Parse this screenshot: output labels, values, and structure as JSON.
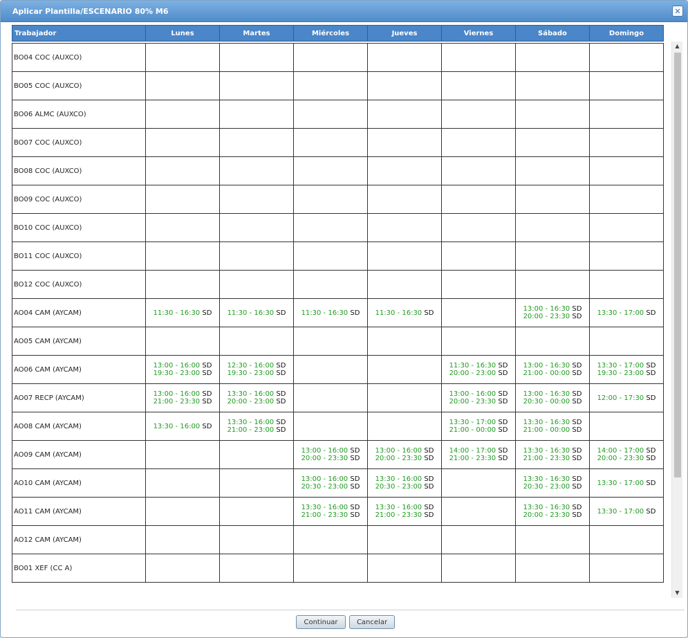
{
  "dialog": {
    "title": "Aplicar Plantilla/ESCENARIO 80% M6",
    "close_label": "✕"
  },
  "table": {
    "headers": [
      "Trabajador",
      "Lunes",
      "Martes",
      "Miércoles",
      "Jueves",
      "Viernes",
      "Sábado",
      "Domingo"
    ],
    "rows": [
      {
        "worker": "BO04 COC (AUXCO)",
        "days": [
          [],
          [],
          [],
          [],
          [],
          [],
          []
        ]
      },
      {
        "worker": "BO05 COC (AUXCO)",
        "days": [
          [],
          [],
          [],
          [],
          [],
          [],
          []
        ]
      },
      {
        "worker": "BO06 ALMC (AUXCO)",
        "days": [
          [],
          [],
          [],
          [],
          [],
          [],
          []
        ]
      },
      {
        "worker": "BO07 COC (AUXCO)",
        "days": [
          [],
          [],
          [],
          [],
          [],
          [],
          []
        ]
      },
      {
        "worker": "BO08 COC (AUXCO)",
        "days": [
          [],
          [],
          [],
          [],
          [],
          [],
          []
        ]
      },
      {
        "worker": "BO09 COC (AUXCO)",
        "days": [
          [],
          [],
          [],
          [],
          [],
          [],
          []
        ]
      },
      {
        "worker": "BO10 COC (AUXCO)",
        "days": [
          [],
          [],
          [],
          [],
          [],
          [],
          []
        ]
      },
      {
        "worker": "BO11 COC (AUXCO)",
        "days": [
          [],
          [],
          [],
          [],
          [],
          [],
          []
        ]
      },
      {
        "worker": "BO12 COC (AUXCO)",
        "days": [
          [],
          [],
          [],
          [],
          [],
          [],
          []
        ]
      },
      {
        "worker": "AO04 CAM (AYCAM)",
        "days": [
          [
            [
              "11:30 - 16:30",
              "SD"
            ]
          ],
          [
            [
              "11:30 - 16:30",
              "SD"
            ]
          ],
          [
            [
              "11:30 - 16:30",
              "SD"
            ]
          ],
          [
            [
              "11:30 - 16:30",
              "SD"
            ]
          ],
          [],
          [
            [
              "13:00 - 16:30",
              "SD"
            ],
            [
              "20:00 - 23:30",
              "SD"
            ]
          ],
          [
            [
              "13:30 - 17:00",
              "SD"
            ]
          ]
        ]
      },
      {
        "worker": "AO05 CAM (AYCAM)",
        "days": [
          [],
          [],
          [],
          [],
          [],
          [],
          []
        ]
      },
      {
        "worker": "AO06 CAM (AYCAM)",
        "days": [
          [
            [
              "13:00 - 16:00",
              "SD"
            ],
            [
              "19:30 - 23:00",
              "SD"
            ]
          ],
          [
            [
              "12:30 - 16:00",
              "SD"
            ],
            [
              "19:30 - 23:00",
              "SD"
            ]
          ],
          [],
          [],
          [
            [
              "11:30 - 16:30",
              "SD"
            ],
            [
              "20:00 - 23:00",
              "SD"
            ]
          ],
          [
            [
              "13:00 - 16:30",
              "SD"
            ],
            [
              "21:00 - 00:00",
              "SD"
            ]
          ],
          [
            [
              "13:30 - 17:00",
              "SD"
            ],
            [
              "19:30 - 23:00",
              "SD"
            ]
          ]
        ]
      },
      {
        "worker": "AO07 RECP (AYCAM)",
        "days": [
          [
            [
              "13:00 - 16:00",
              "SD"
            ],
            [
              "21:00 - 23:30",
              "SD"
            ]
          ],
          [
            [
              "13:30 - 16:00",
              "SD"
            ],
            [
              "20:00 - 23:00",
              "SD"
            ]
          ],
          [],
          [],
          [
            [
              "13:00 - 16:00",
              "SD"
            ],
            [
              "20:00 - 23:30",
              "SD"
            ]
          ],
          [
            [
              "13:00 - 16:30",
              "SD"
            ],
            [
              "20:30 - 00:00",
              "SD"
            ]
          ],
          [
            [
              "12:00 - 17:30",
              "SD"
            ]
          ]
        ]
      },
      {
        "worker": "AO08 CAM (AYCAM)",
        "days": [
          [
            [
              "13:30 - 16:00",
              "SD"
            ]
          ],
          [
            [
              "13:30 - 16:00",
              "SD"
            ],
            [
              "21:00 - 23:00",
              "SD"
            ]
          ],
          [],
          [],
          [
            [
              "13:30 - 17:00",
              "SD"
            ],
            [
              "21:00 - 00:00",
              "SD"
            ]
          ],
          [
            [
              "13:30 - 16:30",
              "SD"
            ],
            [
              "21:00 - 00:00",
              "SD"
            ]
          ],
          []
        ]
      },
      {
        "worker": "AO09 CAM (AYCAM)",
        "days": [
          [],
          [],
          [
            [
              "13:00 - 16:00",
              "SD"
            ],
            [
              "20:00 - 23:30",
              "SD"
            ]
          ],
          [
            [
              "13:00 - 16:00",
              "SD"
            ],
            [
              "20:00 - 23:30",
              "SD"
            ]
          ],
          [
            [
              "14:00 - 17:00",
              "SD"
            ],
            [
              "21:00 - 23:30",
              "SD"
            ]
          ],
          [
            [
              "13:30 - 16:30",
              "SD"
            ],
            [
              "21:00 - 23:30",
              "SD"
            ]
          ],
          [
            [
              "14:00 - 17:00",
              "SD"
            ],
            [
              "20:00 - 23:30",
              "SD"
            ]
          ]
        ]
      },
      {
        "worker": "AO10 CAM (AYCAM)",
        "days": [
          [],
          [],
          [
            [
              "13:00 - 16:00",
              "SD"
            ],
            [
              "20:30 - 23:00",
              "SD"
            ]
          ],
          [
            [
              "13:30 - 16:00",
              "SD"
            ],
            [
              "20:30 - 23:00",
              "SD"
            ]
          ],
          [],
          [
            [
              "13:30 - 16:30",
              "SD"
            ],
            [
              "20:30 - 23:00",
              "SD"
            ]
          ],
          [
            [
              "13:30 - 17:00",
              "SD"
            ]
          ]
        ]
      },
      {
        "worker": "AO11 CAM (AYCAM)",
        "days": [
          [],
          [],
          [
            [
              "13:30 - 16:00",
              "SD"
            ],
            [
              "21:00 - 23:30",
              "SD"
            ]
          ],
          [
            [
              "13:30 - 16:00",
              "SD"
            ],
            [
              "21:00 - 23:30",
              "SD"
            ]
          ],
          [],
          [
            [
              "13:30 - 16:30",
              "SD"
            ],
            [
              "20:00 - 23:30",
              "SD"
            ]
          ],
          [
            [
              "13:30 - 17:00",
              "SD"
            ]
          ]
        ]
      },
      {
        "worker": "AO12 CAM (AYCAM)",
        "days": [
          [],
          [],
          [],
          [],
          [],
          [],
          []
        ]
      },
      {
        "worker": "BO01 XEF (CC A)",
        "days": [
          [],
          [],
          [],
          [],
          [],
          [],
          []
        ]
      }
    ]
  },
  "buttons": {
    "continue_label": "Continuar",
    "cancel_label": "Cancelar"
  },
  "scrollbar": {
    "up_arrow": "▲",
    "down_arrow": "▼"
  },
  "colors": {
    "header_bg": "#4a86c8",
    "title_bar": "#5b95d1",
    "shift_time": "#1f9a1f"
  }
}
